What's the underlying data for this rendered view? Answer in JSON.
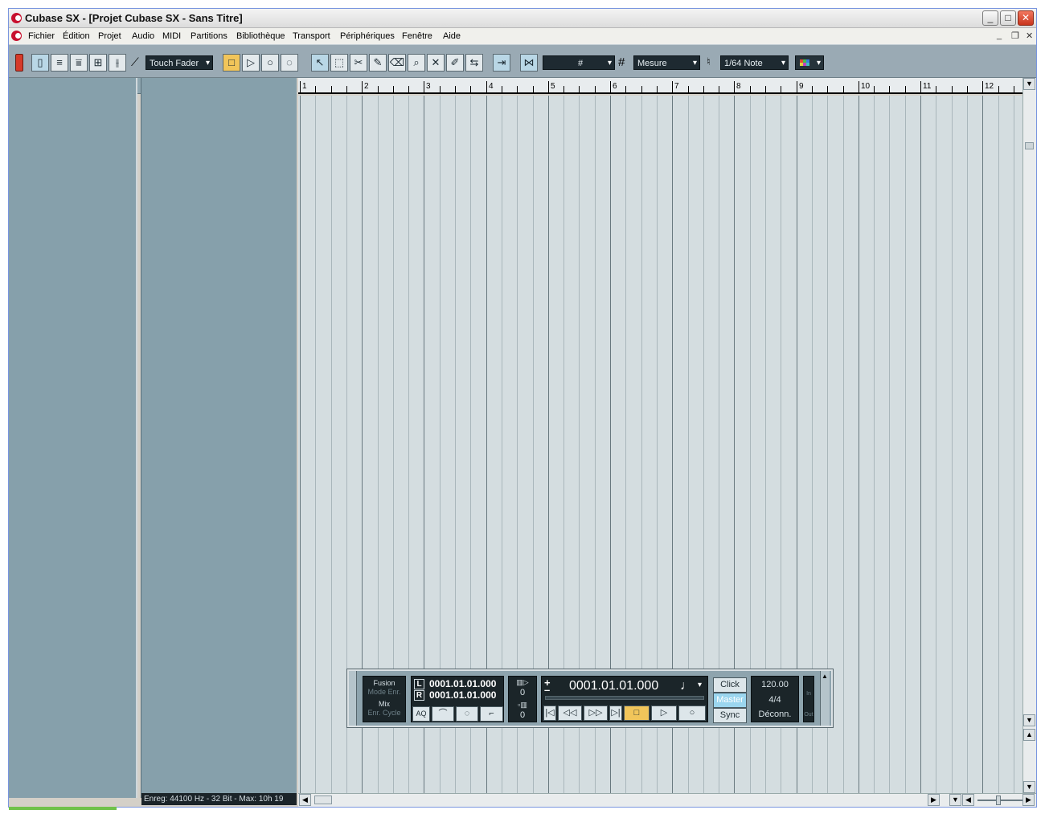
{
  "window": {
    "title": "Cubase SX - [Projet Cubase SX - Sans Titre]"
  },
  "menu": [
    "Fichier",
    "Édition",
    "Projet",
    "Audio",
    "MIDI",
    "Partitions",
    "Bibliothèque",
    "Transport",
    "Périphériques",
    "Fenêtre",
    "Aide"
  ],
  "toolbar": {
    "automation_mode": "Touch Fader",
    "snap_label": "Mesure",
    "quantize_label": "1/64 Note",
    "grid_symbol": "#"
  },
  "ruler": {
    "numbers": [
      "1",
      "2",
      "3",
      "4",
      "5",
      "6",
      "7",
      "8",
      "9",
      "10",
      "11",
      "12"
    ]
  },
  "status_text": "Enreg: 44100 Hz - 32 Bit - Max: 10h 19",
  "transport": {
    "mode_title": "Fusion",
    "mode_enr": "Mode Enr.",
    "mix": "Mix",
    "enr_cycle": "Enr. Cycle",
    "left_locator": "0001.01.01.000",
    "right_locator": "0001.01.01.000",
    "left_label": "L",
    "right_label": "R",
    "pre_roll": "0",
    "post_roll": "0",
    "position": "0001.01.01.000",
    "plus": "+",
    "minus": "–",
    "aq_label": "AQ",
    "click_label": "Click",
    "master_label": "Master",
    "sync_label": "Sync",
    "tempo": "120.00",
    "signature": "4/4",
    "sync_status": "Déconn.",
    "in_label": "In",
    "out_label": "Out"
  },
  "colors": {
    "track_panel": "#86a0ab",
    "grid": "#d4dde0",
    "toolbar": "#9aaab4",
    "accent_play": "#f1c55a"
  }
}
